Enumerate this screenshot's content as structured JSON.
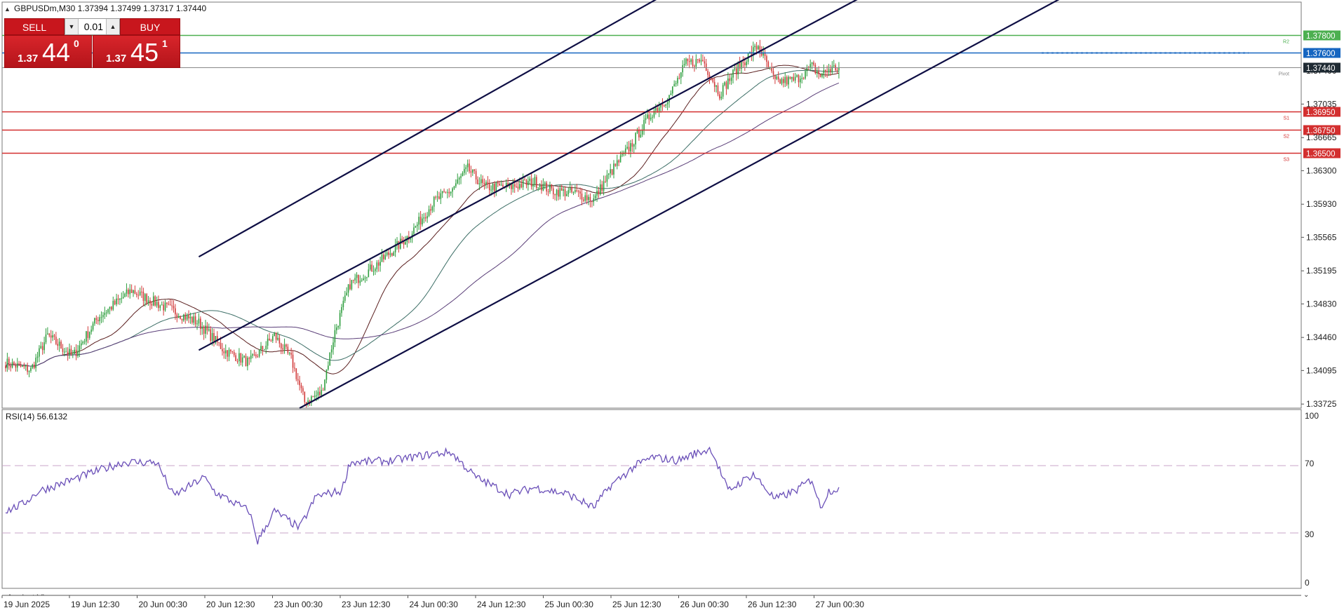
{
  "header": {
    "symbol_line": "GBPUSDm,M30  1.37394 1.37499 1.37317 1.37440"
  },
  "trade_panel": {
    "sell_label": "SELL",
    "buy_label": "BUY",
    "lot_value": "0.01",
    "sell_price_prefix": "1.37",
    "sell_price_big": "44",
    "sell_price_sup": "0",
    "buy_price_prefix": "1.37",
    "buy_price_big": "45",
    "buy_price_sup": "1"
  },
  "price_axis": {
    "ticks": [
      "1.37035",
      "1.36665",
      "1.36300",
      "1.35930",
      "1.35565",
      "1.35195",
      "1.34830",
      "1.34460",
      "1.34095",
      "1.33725"
    ],
    "partial_tick": "1.37400",
    "current_price_label": "1.37440",
    "current_price_color": "#1f2a33"
  },
  "levels": [
    {
      "value": 1.378,
      "label": "1.37800",
      "tag": "R2",
      "color": "#4caf50"
    },
    {
      "value": 1.376,
      "label": "1.37600",
      "tag": "",
      "color": "#1565c0"
    },
    {
      "value": 1.3744,
      "label": "",
      "tag": "Pivot",
      "color": "#888888"
    },
    {
      "value": 1.3695,
      "label": "1.36950",
      "tag": "S1",
      "color": "#d32f2f"
    },
    {
      "value": 1.3675,
      "label": "1.36750",
      "tag": "S2",
      "color": "#d32f2f"
    },
    {
      "value": 1.365,
      "label": "1.36500",
      "tag": "S3",
      "color": "#d32f2f"
    }
  ],
  "time_axis": {
    "labels": [
      "19 Jun 2025",
      "19 Jun 12:30",
      "20 Jun 00:30",
      "20 Jun 12:30",
      "23 Jun 00:30",
      "23 Jun 12:30",
      "24 Jun 00:30",
      "24 Jun 12:30",
      "25 Jun 00:30",
      "25 Jun 12:30",
      "26 Jun 00:30",
      "26 Jun 12:30",
      "27 Jun 00:30"
    ]
  },
  "rsi": {
    "label": "RSI(14) 56.6132",
    "levels": [
      "100",
      "70",
      "30",
      "0"
    ],
    "line_color": "#6a4fb8"
  },
  "bottom_tab": "Analyst Views",
  "colors": {
    "bull": "#2e9e3e",
    "bear": "#d23b3b",
    "channel": "#0e0e44",
    "ma_fast": "#5a1e1e",
    "ma_mid": "#3c6e66",
    "ma_slow": "#5a3e78"
  },
  "chart_data": {
    "type": "candlestick",
    "symbol": "GBPUSDm",
    "timeframe": "M30",
    "last_bar": {
      "open": 1.37394,
      "high": 1.37499,
      "low": 1.37317,
      "close": 1.3744
    },
    "ylim": [
      1.3368,
      1.3816
    ],
    "anchors": [
      [
        0,
        1.3418
      ],
      [
        15,
        1.341
      ],
      [
        25,
        1.3448
      ],
      [
        40,
        1.3425
      ],
      [
        55,
        1.3468
      ],
      [
        75,
        1.3498
      ],
      [
        85,
        1.3488
      ],
      [
        100,
        1.3475
      ],
      [
        115,
        1.3462
      ],
      [
        130,
        1.3432
      ],
      [
        145,
        1.3418
      ],
      [
        160,
        1.3448
      ],
      [
        170,
        1.3422
      ],
      [
        178,
        1.3375
      ],
      [
        188,
        1.3385
      ],
      [
        196,
        1.3452
      ],
      [
        205,
        1.3505
      ],
      [
        220,
        1.3525
      ],
      [
        240,
        1.3558
      ],
      [
        255,
        1.3596
      ],
      [
        265,
        1.3608
      ],
      [
        275,
        1.3632
      ],
      [
        285,
        1.3612
      ],
      [
        300,
        1.3612
      ],
      [
        315,
        1.3618
      ],
      [
        325,
        1.3608
      ],
      [
        340,
        1.3605
      ],
      [
        350,
        1.3598
      ],
      [
        360,
        1.3628
      ],
      [
        370,
        1.3652
      ],
      [
        385,
        1.3695
      ],
      [
        395,
        1.3712
      ],
      [
        405,
        1.3748
      ],
      [
        415,
        1.3752
      ],
      [
        425,
        1.3715
      ],
      [
        435,
        1.3742
      ],
      [
        448,
        1.3768
      ],
      [
        458,
        1.3728
      ],
      [
        470,
        1.373
      ],
      [
        480,
        1.3745
      ],
      [
        485,
        1.3735
      ],
      [
        490,
        1.3742
      ],
      [
        496,
        1.3744
      ]
    ],
    "rsi_anchors": [
      [
        0,
        43
      ],
      [
        10,
        47
      ],
      [
        20,
        55
      ],
      [
        35,
        60
      ],
      [
        55,
        67
      ],
      [
        70,
        72
      ],
      [
        90,
        72
      ],
      [
        100,
        52
      ],
      [
        118,
        63
      ],
      [
        125,
        54
      ],
      [
        145,
        43
      ],
      [
        150,
        25
      ],
      [
        160,
        43
      ],
      [
        175,
        33
      ],
      [
        185,
        52
      ],
      [
        200,
        55
      ],
      [
        205,
        72
      ],
      [
        230,
        73
      ],
      [
        255,
        77
      ],
      [
        265,
        78
      ],
      [
        280,
        63
      ],
      [
        300,
        53
      ],
      [
        315,
        57
      ],
      [
        335,
        53
      ],
      [
        350,
        45
      ],
      [
        360,
        58
      ],
      [
        375,
        70
      ],
      [
        385,
        75
      ],
      [
        400,
        73
      ],
      [
        410,
        77
      ],
      [
        420,
        80
      ],
      [
        430,
        55
      ],
      [
        445,
        65
      ],
      [
        458,
        50
      ],
      [
        470,
        55
      ],
      [
        480,
        62
      ],
      [
        485,
        45
      ],
      [
        490,
        55
      ],
      [
        496,
        56.6
      ]
    ],
    "channels": [
      {
        "name": "upper",
        "x1": 115,
        "y1": 1.3535,
        "x2": 393,
        "y2": 1.3825
      },
      {
        "name": "middle",
        "x1": 115,
        "y1": 1.3432,
        "x2": 513,
        "y2": 1.3825
      },
      {
        "name": "lower",
        "x1": 175,
        "y1": 1.3368,
        "x2": 633,
        "y2": 1.3825
      }
    ]
  }
}
